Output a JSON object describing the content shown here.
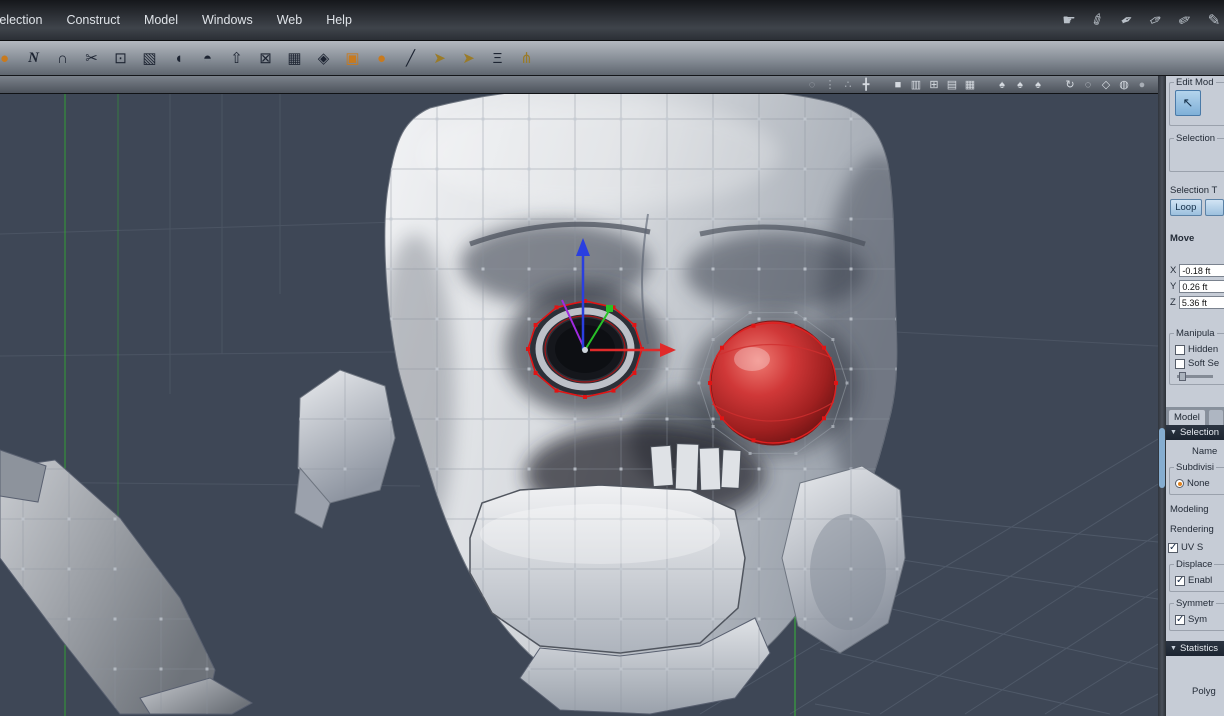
{
  "accent_colors": {
    "viewport_bg": "#3e4756",
    "panel_bg": "#c6ccd6",
    "selection_red": "#e01414",
    "axis_x_red": "#e02a2a",
    "axis_y_green": "#28c128",
    "axis_z_blue": "#2a3fe0",
    "grid_green": "#2fae2f",
    "eye_sphere_red": "#c03030"
  },
  "menubar": {
    "items": [
      "Selection",
      "Construct",
      "Model",
      "Windows",
      "Web",
      "Help"
    ],
    "icons": [
      {
        "name": "pan-hand-icon",
        "glyph": "☛"
      },
      {
        "name": "airbrush-tool-icon",
        "glyph": "✐"
      },
      {
        "name": "pen-tool-icon",
        "glyph": "✒"
      },
      {
        "name": "ink-tool-icon",
        "glyph": "✑"
      },
      {
        "name": "pencil-tool-icon",
        "glyph": "✏"
      },
      {
        "name": "eraser-tool-icon",
        "glyph": "✎"
      }
    ]
  },
  "toolbar": {
    "tools": [
      {
        "name": "sphere-primitive-tool",
        "glyph": "●"
      },
      {
        "name": "curve-n-tool",
        "glyph": "N"
      },
      {
        "name": "magnet-tool",
        "glyph": "∩"
      },
      {
        "name": "scissors-tool",
        "glyph": "✂"
      },
      {
        "name": "quantize-tool",
        "glyph": "⊡"
      },
      {
        "name": "lasso-select-tool",
        "glyph": "▧"
      },
      {
        "name": "dome-tool",
        "glyph": "◖"
      },
      {
        "name": "mirror-tool",
        "glyph": "◓"
      },
      {
        "name": "extrude-tool",
        "glyph": "⇧"
      },
      {
        "name": "box-select-tool",
        "glyph": "⊠"
      },
      {
        "name": "checker-tool",
        "glyph": "▦"
      },
      {
        "name": "gem-tool",
        "glyph": "◈"
      },
      {
        "name": "package-tool",
        "glyph": "▣"
      },
      {
        "name": "ball-tool",
        "glyph": "●"
      },
      {
        "name": "slash-tool",
        "glyph": "╱"
      },
      {
        "name": "sweep-arrow-tool",
        "glyph": "➤"
      },
      {
        "name": "bridge-arrow-tool",
        "glyph": "➤"
      },
      {
        "name": "rails-tool",
        "glyph": "Ξ"
      },
      {
        "name": "skeleton-tool",
        "glyph": "⋔"
      }
    ]
  },
  "viewport": {
    "header_icons": [
      {
        "name": "ghost-shading-icon",
        "glyph": "◌"
      },
      {
        "name": "vertex-display-icon",
        "glyph": "⋮"
      },
      {
        "name": "falloff-display-icon",
        "glyph": "∴"
      },
      {
        "name": "action-center-icon",
        "glyph": "╋"
      },
      {
        "name": "layout-single-icon",
        "glyph": "■"
      },
      {
        "name": "layout-split-icon",
        "glyph": "▥"
      },
      {
        "name": "layout-quad-icon",
        "glyph": "⊞"
      },
      {
        "name": "layout-rows-icon",
        "glyph": "▤"
      },
      {
        "name": "layout-grid-icon",
        "glyph": "▦"
      },
      {
        "name": "shield-wire-icon",
        "glyph": "♠"
      },
      {
        "name": "shield-shade-icon",
        "glyph": "♠"
      },
      {
        "name": "shield-texture-icon",
        "glyph": "♠"
      },
      {
        "name": "orbit-view-icon",
        "glyph": "↻"
      },
      {
        "name": "dashed-circle-icon",
        "glyph": "◌"
      },
      {
        "name": "wire-cube-icon",
        "glyph": "◇"
      },
      {
        "name": "shaded-sphere-icon",
        "glyph": "◍"
      },
      {
        "name": "flat-sphere-icon",
        "glyph": "●"
      }
    ]
  },
  "panel": {
    "edit_mode_group": "Edit Mod",
    "edit_mode_icon_glyph": "↖",
    "selection_group": "Selection",
    "selection_type_label": "Selection T",
    "loop_button": "Loop",
    "move_label": "Move",
    "coords": [
      {
        "axis": "X",
        "value": "-0.18 ft"
      },
      {
        "axis": "Y",
        "value": "0.26 ft"
      },
      {
        "axis": "Z",
        "value": "5.36 ft"
      }
    ],
    "manipulators_group": "Manipula",
    "hidden_checkbox_label": "Hidden",
    "soft_selection_checkbox_label": "Soft Se",
    "model_tab": "Model",
    "selection_section": "Selection",
    "name_label": "Name",
    "subdivision_group": "Subdivisi",
    "none_radio_label": "None",
    "modeling_label": "Modeling",
    "rendering_label": "Rendering",
    "uv_checkbox_label": "UV S",
    "displacement_group": "Displace",
    "enable_checkbox_label": "Enabl",
    "symmetry_group": "Symmetr",
    "sym_checkbox_label": "Sym",
    "statistics_section": "Statistics",
    "polygons_label": "Polyg"
  }
}
